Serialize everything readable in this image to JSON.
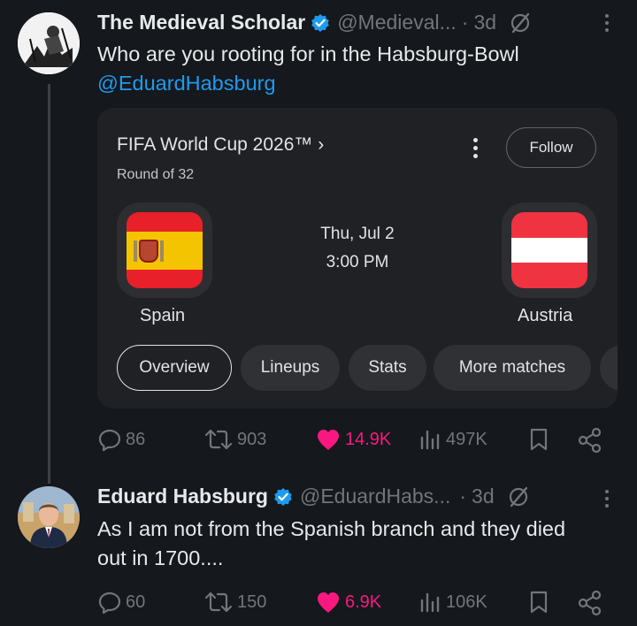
{
  "tweet1": {
    "author_name": "The Medieval Scholar",
    "handle": "@Medieval...",
    "dot": "·",
    "time": "3d",
    "text": "Who are you rooting for in the Habsburg-Bowl",
    "mention": "@EduardHabsburg",
    "stats": {
      "replies": "86",
      "retweets": "903",
      "likes": "14.9K",
      "views": "497K"
    }
  },
  "card": {
    "title": "FIFA World Cup 2026™ ›",
    "subtitle": "Round of 32",
    "follow_label": "Follow",
    "home_team": "Spain",
    "away_team": "Austria",
    "date": "Thu, Jul 2",
    "time": "3:00 PM",
    "tabs": [
      "Overview",
      "Lineups",
      "Stats",
      "More matches"
    ],
    "active_tab": "Overview"
  },
  "tweet2": {
    "author_name": "Eduard Habsburg",
    "handle": "@EduardHabs...",
    "dot": "·",
    "time": "3d",
    "text_line1": "As I am not from the Spanish branch and they died",
    "text_line2": "out in 1700....",
    "stats": {
      "replies": "60",
      "retweets": "150",
      "likes": "6.9K",
      "views": "106K"
    }
  },
  "colors": {
    "background": "#15181c",
    "link": "#1d9bf0",
    "like": "#f91880",
    "muted": "#71767b",
    "verified": "#1d9bf0",
    "spain_red": "#e8202a",
    "spain_yellow": "#f5c400",
    "austria_red": "#ef3340"
  },
  "icons": [
    "verified-badge-icon",
    "grok-icon",
    "more-icon",
    "reply-icon",
    "retweet-icon",
    "heart-icon",
    "views-icon",
    "bookmark-icon",
    "share-icon"
  ]
}
